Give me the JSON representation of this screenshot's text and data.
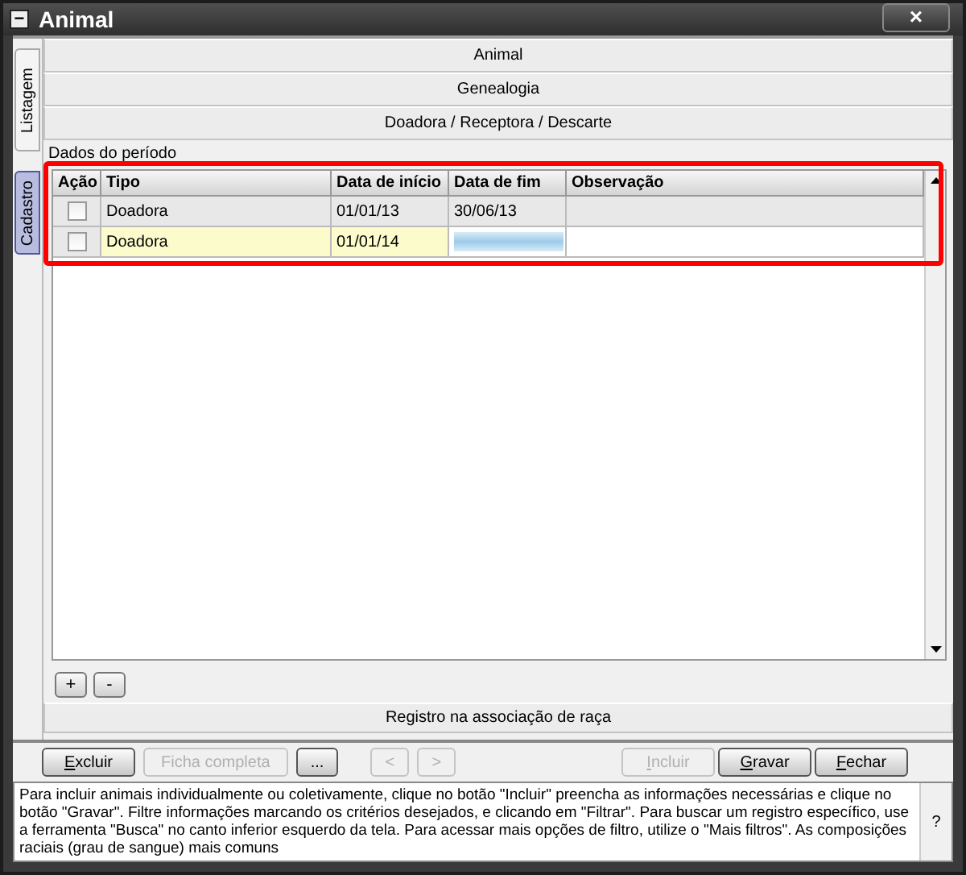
{
  "window": {
    "title": "Animal",
    "close": "×",
    "menu": "−"
  },
  "side_tabs": [
    {
      "label": "Listagem",
      "selected": false
    },
    {
      "label": "Cadastro",
      "selected": true
    }
  ],
  "sections": [
    "Animal",
    "Genealogia",
    "Doadora / Receptora / Descarte"
  ],
  "period_label": "Dados do período",
  "table": {
    "columns": [
      "Ação",
      "Tipo",
      "Data de início",
      "Data de fim",
      "Observação"
    ],
    "rows": [
      {
        "checked": false,
        "tipo": "Doadora",
        "inicio": "01/01/13",
        "fim": "30/06/13",
        "editing": false
      },
      {
        "checked": false,
        "tipo": "Doadora",
        "inicio": "01/01/14",
        "editing": true
      }
    ]
  },
  "row_buttons": [
    "+",
    "-"
  ],
  "bottom_section": "Registro na associação de raça",
  "buttons_left": [
    {
      "label": "Excluir",
      "disabled": false,
      "mnemonic": true
    },
    {
      "label": "Ficha completa",
      "disabled": true,
      "mnemonic": false
    },
    {
      "label": "...",
      "disabled": false,
      "mnemonic": false
    }
  ],
  "buttons_nav": [
    {
      "label": "<",
      "disabled": true,
      "mnemonic": false
    },
    {
      "label": ">",
      "disabled": true,
      "mnemonic": false
    }
  ],
  "buttons_right": [
    {
      "label": "Incluir",
      "disabled": true,
      "mnemonic": true
    },
    {
      "label": "Gravar",
      "disabled": false,
      "mnemonic": true
    },
    {
      "label": "Fechar",
      "disabled": false,
      "mnemonic": true
    }
  ],
  "help": {
    "text": "Para incluir animais individualmente ou coletivamente, clique no botão \"Incluir\" preencha as informações necessárias e clique no botão \"Gravar\". Filtre informações marcando os critérios desejados, e clicando em \"Filtrar\". Para buscar um registro específico, use a ferramenta \"Busca\" no canto inferior esquerdo da tela. Para acessar mais opções de filtro, utilize o \"Mais filtros\". As composições raciais (grau de sangue) mais comuns",
    "button": "?"
  },
  "highlight": true
}
